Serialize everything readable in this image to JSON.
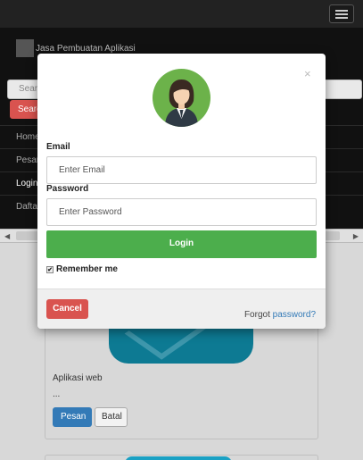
{
  "background": {
    "brand_name": "Jasa Pembuatan Aplikasi",
    "search_placeholder": "Search",
    "search_button": "Search",
    "nav_items": [
      "Home",
      "Pesan",
      "Login",
      "Daftar"
    ],
    "active_nav": "Login",
    "card": {
      "title": "Aplikasi web",
      "description": "...",
      "order_button": "Pesan",
      "cancel_button": "Batal"
    }
  },
  "modal": {
    "close_glyph": "×",
    "email_label": "Email",
    "email_placeholder": "Enter Email",
    "password_label": "Password",
    "password_placeholder": "Enter Password",
    "login_button": "Login",
    "remember_label": "Remember me",
    "remember_checked": true,
    "cancel_button": "Cancel",
    "forgot_prefix": "Forgot",
    "forgot_link": "password?"
  },
  "colors": {
    "login_green": "#4cae4c",
    "cancel_red": "#d9534f",
    "link_blue": "#337ab7"
  }
}
